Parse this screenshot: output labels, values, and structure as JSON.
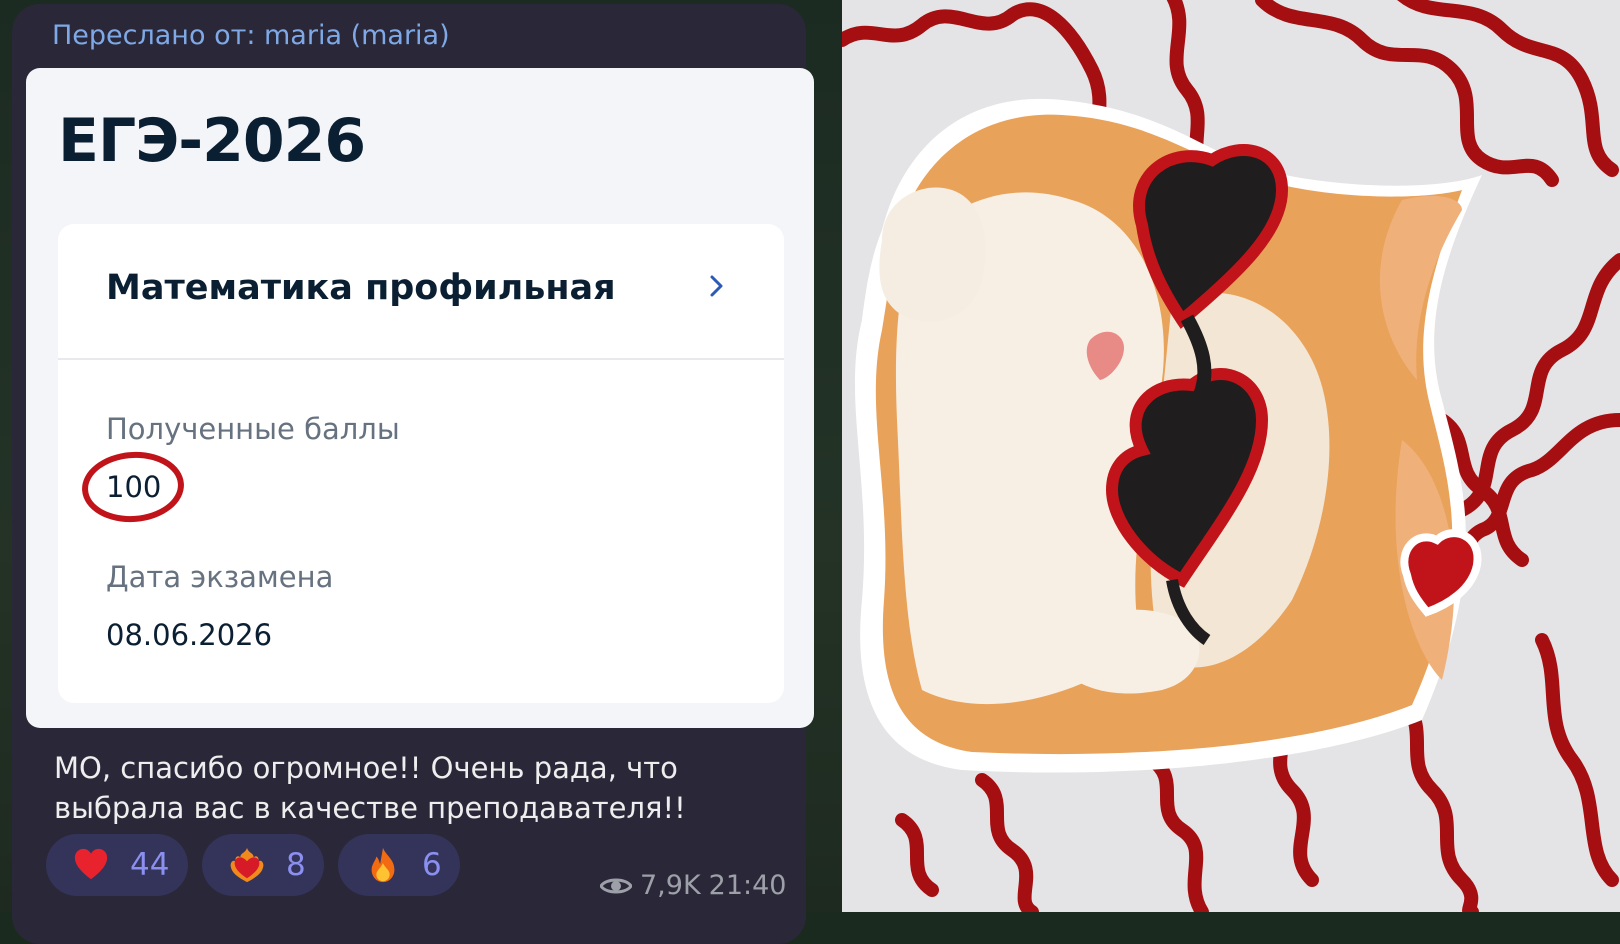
{
  "message": {
    "forward_label": "Переслано от: maria (maria)",
    "exam_title": "ЕГЭ-2026",
    "subject": "Математика профильная",
    "score_label": "Полученные баллы",
    "score_value": "100",
    "date_label": "Дата экзамена",
    "date_value": "08.06.2026",
    "caption": "МО, спасибо огромное!! Очень рада, что выбрала вас в качестве преподавателя!!",
    "reactions": [
      {
        "icon": "heart-icon",
        "count": "44"
      },
      {
        "icon": "heart-on-fire-icon",
        "count": "8"
      },
      {
        "icon": "fire-icon",
        "count": "6"
      }
    ],
    "views": "7,9K",
    "time": "21:40"
  },
  "colors": {
    "bubble": "#2a2838",
    "forward": "#7fa9e6",
    "score_circle": "#c0141a",
    "reaction_bg": "#34335a",
    "reaction_count": "#8a8ff0",
    "sticker_lines": "#a50f12"
  },
  "sticker": {
    "icon": "cat-with-heart-sunglasses-sticker"
  }
}
